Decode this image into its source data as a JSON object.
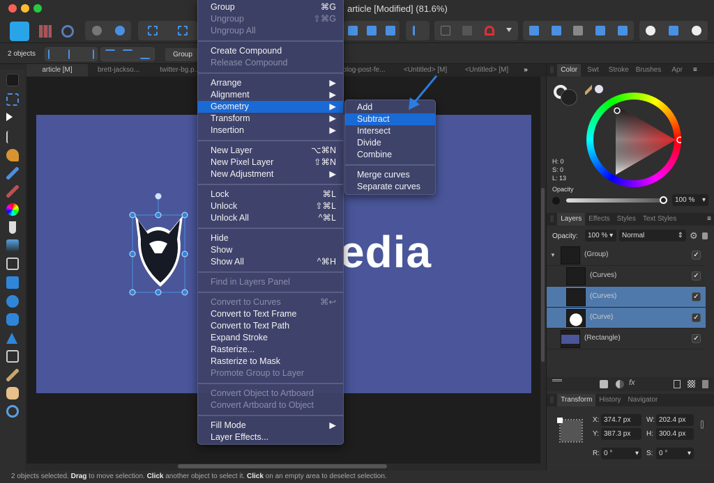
{
  "window": {
    "title": "article [Modified] (81.6%)"
  },
  "context_bar": {
    "selection": "2 objects",
    "group_label": "Group"
  },
  "doc_tabs": [
    "article [M]",
    "brett-jackso...",
    "twitter-bg.p...",
    "",
    "",
    "blog-post-fe...",
    "<Untitled> [M]",
    "<Untitled> [M]"
  ],
  "doc_tabs_more": "»",
  "menu": {
    "items": [
      {
        "label": "Group",
        "shortcut": "⌘G",
        "enabled": true
      },
      {
        "label": "Ungroup",
        "shortcut": "⇧⌘G",
        "enabled": false
      },
      {
        "label": "Ungroup All",
        "shortcut": "",
        "enabled": false
      },
      {
        "sep": true
      },
      {
        "label": "Create Compound",
        "shortcut": "",
        "enabled": true
      },
      {
        "label": "Release Compound",
        "shortcut": "",
        "enabled": false
      },
      {
        "sep": true
      },
      {
        "label": "Arrange",
        "shortcut": "▶",
        "enabled": true
      },
      {
        "label": "Alignment",
        "shortcut": "▶",
        "enabled": true
      },
      {
        "label": "Geometry",
        "shortcut": "▶",
        "enabled": true,
        "highlighted": true
      },
      {
        "label": "Transform",
        "shortcut": "▶",
        "enabled": true
      },
      {
        "label": "Insertion",
        "shortcut": "▶",
        "enabled": true
      },
      {
        "sep": true
      },
      {
        "label": "New Layer",
        "shortcut": "⌥⌘N",
        "enabled": true
      },
      {
        "label": "New Pixel Layer",
        "shortcut": "⇧⌘N",
        "enabled": true
      },
      {
        "label": "New Adjustment",
        "shortcut": "▶",
        "enabled": true
      },
      {
        "sep": true
      },
      {
        "label": "Lock",
        "shortcut": "⌘L",
        "enabled": true
      },
      {
        "label": "Unlock",
        "shortcut": "⇧⌘L",
        "enabled": true
      },
      {
        "label": "Unlock All",
        "shortcut": "^⌘L",
        "enabled": true
      },
      {
        "sep": true
      },
      {
        "label": "Hide",
        "shortcut": "",
        "enabled": true
      },
      {
        "label": "Show",
        "shortcut": "",
        "enabled": true
      },
      {
        "label": "Show All",
        "shortcut": "^⌘H",
        "enabled": true
      },
      {
        "sep": true
      },
      {
        "label": "Find in Layers Panel",
        "shortcut": "",
        "enabled": false
      },
      {
        "sep": true
      },
      {
        "label": "Convert to Curves",
        "shortcut": "⌘↩",
        "enabled": false
      },
      {
        "label": "Convert to Text Frame",
        "shortcut": "",
        "enabled": true
      },
      {
        "label": "Convert to Text Path",
        "shortcut": "",
        "enabled": true
      },
      {
        "label": "Expand Stroke",
        "shortcut": "",
        "enabled": true
      },
      {
        "label": "Rasterize...",
        "shortcut": "",
        "enabled": true
      },
      {
        "label": "Rasterize to Mask",
        "shortcut": "",
        "enabled": true
      },
      {
        "label": "Promote Group to Layer",
        "shortcut": "",
        "enabled": false
      },
      {
        "sep": true
      },
      {
        "label": "Convert Object to Artboard",
        "shortcut": "",
        "enabled": false
      },
      {
        "label": "Convert Artboard to Object",
        "shortcut": "",
        "enabled": false
      },
      {
        "sep": true
      },
      {
        "label": "Fill Mode",
        "shortcut": "▶",
        "enabled": true
      },
      {
        "label": "Layer Effects...",
        "shortcut": "",
        "enabled": true
      }
    ]
  },
  "submenu": {
    "items": [
      {
        "label": "Add"
      },
      {
        "label": "Subtract",
        "highlighted": true
      },
      {
        "label": "Intersect"
      },
      {
        "label": "Divide"
      },
      {
        "label": "Combine"
      },
      {
        "sep": true
      },
      {
        "label": "Merge curves"
      },
      {
        "label": "Separate curves"
      }
    ]
  },
  "canvas": {
    "visible_text": "edia",
    "artboard_color": "#4a5699"
  },
  "color_panel": {
    "tabs": [
      "Color",
      "Swt",
      "Stroke",
      "Brushes",
      "Apr"
    ],
    "h": "H: 0",
    "s": "S: 0",
    "l": "L: 13",
    "opacity_label": "Opacity",
    "opacity_value": "100 %",
    "opacity_fraction": 1.0
  },
  "layers_panel": {
    "tabs": [
      "Layers",
      "Effects",
      "Styles",
      "Text Styles"
    ],
    "opacity_label": "Opacity:",
    "opacity_value": "100 %",
    "blend_mode": "Normal",
    "layers": [
      {
        "name": "(Group)",
        "selected": false,
        "visible": true
      },
      {
        "name": "(Curves)",
        "selected": false,
        "visible": true
      },
      {
        "name": "(Curves)",
        "selected": true,
        "visible": true
      },
      {
        "name": "(Curve)",
        "selected": true,
        "visible": true
      },
      {
        "name": "(Rectangle)",
        "selected": false,
        "visible": true
      }
    ],
    "fx_label": "fx"
  },
  "transform_panel": {
    "tabs": [
      "Transform",
      "History",
      "Navigator"
    ],
    "x_label": "X:",
    "x": "374.7 px",
    "y_label": "Y:",
    "y": "387.3 px",
    "w_label": "W:",
    "w": "202.4 px",
    "h_label": "H:",
    "h": "300.4 px",
    "r_label": "R:",
    "r": "0 °",
    "s_label": "S:",
    "s": "0 °"
  },
  "status": {
    "p1": "2 objects selected. ",
    "b1": "Drag",
    "p2": " to move selection. ",
    "b2": "Click",
    "p3": " another object to select it. ",
    "b3": "Click",
    "p4": " on an empty area to deselect selection."
  },
  "colors": {
    "accent": "#1a6ad6",
    "selection": "#5079ab",
    "arrow": "#2b7de0"
  }
}
